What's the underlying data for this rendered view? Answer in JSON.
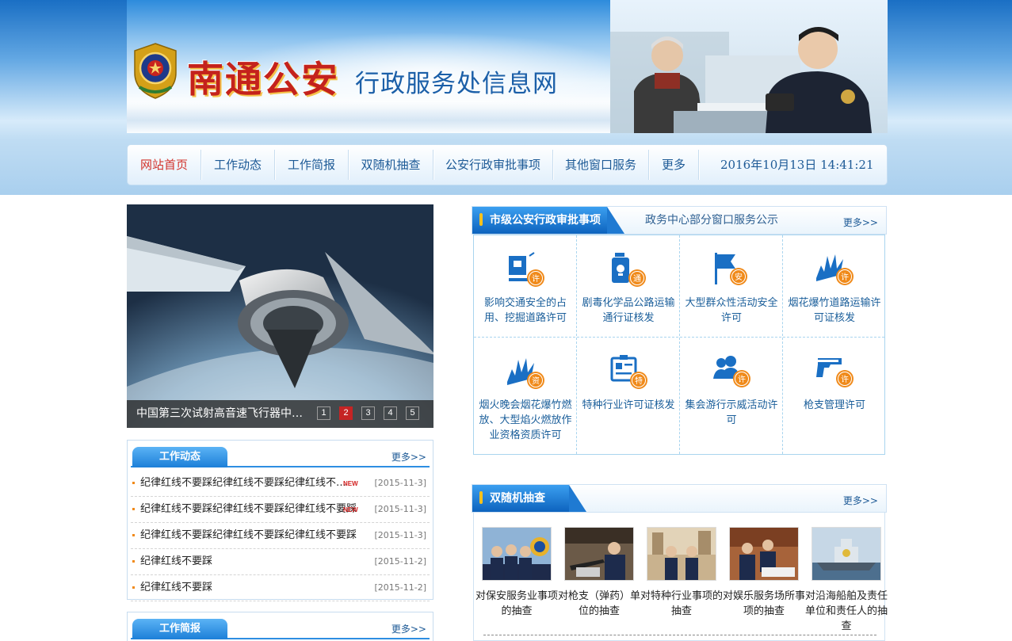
{
  "site": {
    "logo_text": "南通公安",
    "site_name": "行政服务处信息网"
  },
  "nav": {
    "items": [
      "网站首页",
      "工作动态",
      "工作简报",
      "双随机抽查",
      "公安行政审批事项",
      "其他窗口服务",
      "更多"
    ],
    "clock": "2016年10月13日 14:41:21"
  },
  "slider": {
    "caption": "中国第三次试射高音速飞行器中…",
    "pages": [
      "1",
      "2",
      "3",
      "4",
      "5"
    ],
    "active_page": "2"
  },
  "work_news": {
    "title": "工作动态",
    "more": "更多>>",
    "new_badge": "NEW",
    "items": [
      {
        "title": "纪律红线不要踩纪律红线不要踩纪律红线不…",
        "date": "[2015-11-3]",
        "is_new": true
      },
      {
        "title": "纪律红线不要踩纪律红线不要踩纪律红线不要踩",
        "date": "[2015-11-3]",
        "is_new": true
      },
      {
        "title": "纪律红线不要踩纪律红线不要踩纪律红线不要踩",
        "date": "[2015-11-3]",
        "is_new": false
      },
      {
        "title": "纪律红线不要踩",
        "date": "[2015-11-2]",
        "is_new": false
      },
      {
        "title": "纪律红线不要踩",
        "date": "[2015-11-2]",
        "is_new": false
      }
    ]
  },
  "work_brief": {
    "title": "工作简报",
    "more": "更多>>"
  },
  "approval": {
    "title": "市级公安行政审批事项",
    "subtitle": "政务中心部分窗口服务公示",
    "more": "更多>>",
    "items": [
      {
        "label": "影响交通安全的占用、挖掘道路许可",
        "icon": "road-permit-icon",
        "badge": "许"
      },
      {
        "label": "剧毒化学品公路运输通行证核发",
        "icon": "hazardous-chemical-icon",
        "badge": "通"
      },
      {
        "label": "大型群众性活动安全许可",
        "icon": "event-flag-icon",
        "badge": "安"
      },
      {
        "label": "烟花爆竹道路运输许可证核发",
        "icon": "fireworks-transport-icon",
        "badge": "许"
      },
      {
        "label": "烟火晚会烟花爆竹燃放、大型焰火燃放作业资格资质许可",
        "icon": "fireworks-display-icon",
        "badge": "资"
      },
      {
        "label": "特种行业许可证核发",
        "icon": "special-industry-icon",
        "badge": "特"
      },
      {
        "label": "集会游行示威活动许可",
        "icon": "assembly-icon",
        "badge": "许"
      },
      {
        "label": "枪支管理许可",
        "icon": "gun-icon",
        "badge": "许"
      }
    ]
  },
  "random_check": {
    "title": "双随机抽查",
    "more": "更多>>",
    "items": [
      {
        "label": "对保安服务业事项的抽查"
      },
      {
        "label": "对枪支（弹药）单位的抽查"
      },
      {
        "label": "对特种行业事项的抽查"
      },
      {
        "label": "对娱乐服务场所事项的抽查"
      },
      {
        "label": "对沿海船舶及责任单位和责任人的抽查"
      }
    ]
  },
  "colors": {
    "brand_blue": "#1c7fd8",
    "nav_text": "#1d5a96",
    "active_red": "#d2322a",
    "badge_orange": "#f08a1a"
  }
}
